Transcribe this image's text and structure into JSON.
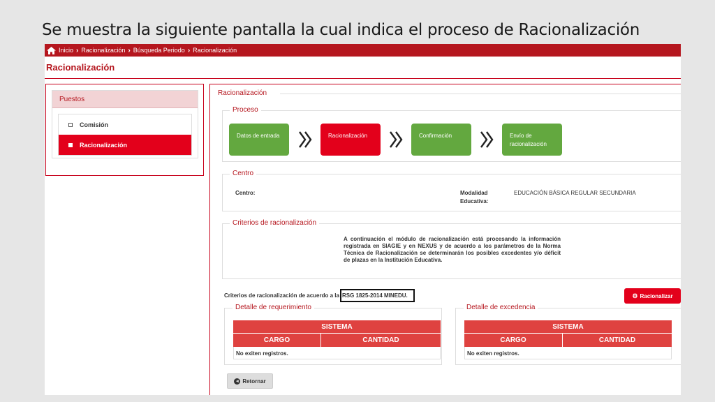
{
  "slide": {
    "title": "Se muestra la siguiente pantalla la cual indica el proceso de Racionalización"
  },
  "breadcrumb": [
    "Inicio",
    "Racionalización",
    "Búsqueda Periodo",
    "Racionalización"
  ],
  "page_title": "Racionalización",
  "sidebar": {
    "title": "Puestos",
    "items": [
      {
        "label": "Comisión",
        "active": false
      },
      {
        "label": "Racionalización",
        "active": true
      }
    ]
  },
  "main": {
    "legend": "Racionalización",
    "proceso": {
      "legend": "Proceso",
      "steps": [
        {
          "label": "Datos de entrada",
          "color": "#63a83f"
        },
        {
          "label": "Racionalización",
          "color": "#e3001b"
        },
        {
          "label": "Confirmación",
          "color": "#63a83f"
        },
        {
          "label": "Envío de racionalización",
          "color": "#63a83f"
        }
      ],
      "arrow_icon": "double-chevron-right-icon"
    },
    "centro": {
      "legend": "Centro",
      "centro_label": "Centro:",
      "centro_value": "",
      "modalidad_label": "Modalidad Educativa:",
      "modalidad_value": "EDUCACIÓN BÁSICA REGULAR SECUNDARIA"
    },
    "criterios": {
      "legend": "Criterios de racionalización",
      "description": "A continuación el módulo de racionalización está procesando la información registrada en SIAGIE y en NEXUS y de acuerdo a los parámetros de la Norma Técnica de Racionalización se determinarán los posibles excedentes y/o déficit de plazas en la Institución Educativa."
    },
    "criteria_text": "Criterios de racionalización de acuerdo a la",
    "rsg": "RSG 1825-2014 MINEDU.",
    "racionalizar_button": "Racionalizar",
    "requerimiento": {
      "legend": "Detalle de requerimiento",
      "system": "SISTEMA",
      "columns": [
        "CARGO",
        "CANTIDAD"
      ],
      "empty": "No exiten registros."
    },
    "excedencia": {
      "legend": "Detalle de excedencia",
      "system": "SISTEMA",
      "columns": [
        "CARGO",
        "CANTIDAD"
      ],
      "empty": "No exiten registros."
    },
    "retornar_button": "Retornar"
  },
  "colors": {
    "brand_red": "#b5161e",
    "active_red": "#e3001b",
    "table_red": "#df4240",
    "step_green": "#63a83f"
  }
}
